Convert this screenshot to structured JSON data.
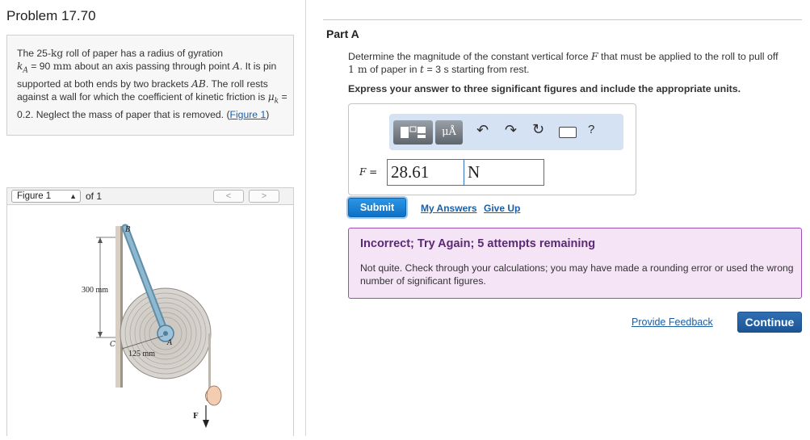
{
  "problem": {
    "title": "Problem 17.70",
    "text_1": "The 25-",
    "text_kg": "kg",
    "text_2": " roll of paper has a radius of gyration",
    "k_symbol": "k",
    "k_sub": "A",
    "text_3": " = 90 ",
    "text_mm": "mm",
    "text_4": " about an axis passing through point ",
    "point_a": "A",
    "text_5": ". It is pin supported at both ends by two brackets ",
    "brackets": "AB",
    "text_6": ". The roll rests against a wall for which the coefficient of kinetic friction is ",
    "mu_symbol": "μ",
    "mu_sub": "k",
    "text_7": " = 0.2. Neglect the mass of paper that is removed. (",
    "figure_link": "Figure 1",
    "text_8": ")"
  },
  "figure_nav": {
    "selected": "Figure 1",
    "of_text": "of 1",
    "prev": "<",
    "next": ">"
  },
  "figure": {
    "label_b": "B",
    "label_c": "C",
    "label_a": "A",
    "label_f": "F",
    "dim_300": "300 mm",
    "dim_125": "125 mm"
  },
  "part": {
    "title": "Part A",
    "q_1": "Determine the magnitude of the constant vertical force ",
    "q_F": "F",
    "q_2": " that must be applied to the roll to pull off ",
    "q_1m": "1 m",
    "q_3": " of paper in ",
    "q_t": "t",
    "q_4": " = 3 s starting from rest.",
    "instruction": "Express your answer to three significant figures and include the appropriate units."
  },
  "toolbar": {
    "units_label": "μÅ",
    "undo": "undo-icon",
    "redo": "redo-icon",
    "reset": "reset-icon",
    "keyboard": "keyboard-icon",
    "help": "?"
  },
  "answer": {
    "label": "F =",
    "value": "28.61",
    "unit": "N"
  },
  "actions": {
    "submit": "Submit",
    "my_answers": "My Answers",
    "give_up": "Give Up",
    "provide_feedback": "Provide Feedback",
    "continue": "Continue"
  },
  "feedback": {
    "title": "Incorrect; Try Again; 5 attempts remaining",
    "message": "Not quite. Check through your calculations; you may have made a rounding error or used the wrong number of significant figures."
  },
  "colors": {
    "link": "#1a5ea8",
    "submit": "#1574c9",
    "feedback_border": "#9b4fb0",
    "feedback_bg": "#f5e4f6",
    "toolbar_bg": "#d5e2f4",
    "roll": "#d8d4cf",
    "bracket": "#7fa9c2"
  }
}
